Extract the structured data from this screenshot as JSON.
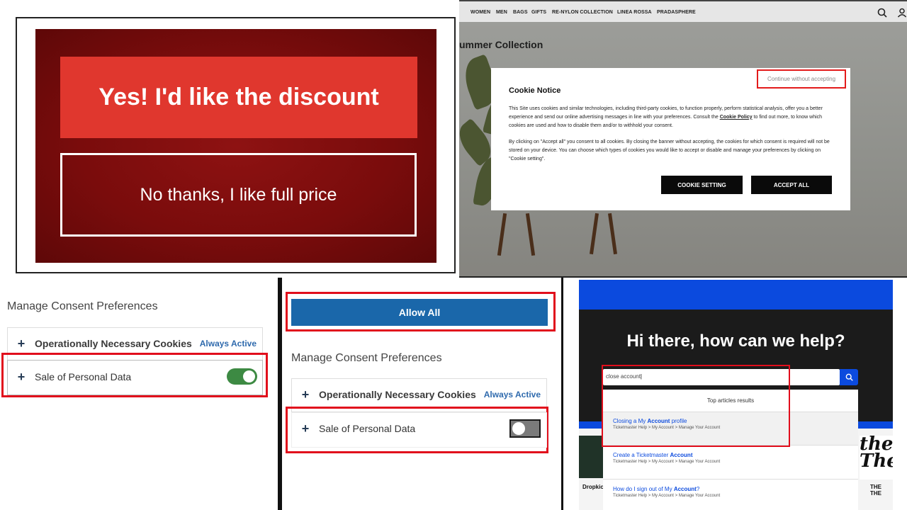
{
  "panel_discount": {
    "accept_label": "Yes! I'd like the discount",
    "decline_label": "No thanks, I like full price"
  },
  "panel_prada": {
    "nav": [
      "WOMEN",
      "MEN",
      "BAGS",
      "GIFTS",
      "RE-NYLON COLLECTION",
      "LINEA ROSSA",
      "PRADASPHERE"
    ],
    "collection_text": "ummer Collection",
    "cookie_title": "Cookie Notice",
    "continue_label": "Continue without accepting",
    "body_1": "This Site uses cookies and similar technologies, including third-party cookies, to function properly, perform statistical analysis, offer you a better experience and send our online advertising messages in line with your preferences. Consult the",
    "policy_link": "Cookie Policy",
    "body_1_end": " to find out more, to know which cookies are used and how to disable them and/or to withhold your consent.",
    "body_2": "By clicking on \"Accept all\" you consent to all cookies. By closing the banner without accepting, the cookies for which consent is required will not be stored on your device. You can choose which types of cookies you would like to accept or disable and manage your preferences by clicking on \"Cookie setting\".",
    "cookie_setting_label": "COOKIE SETTING",
    "accept_all_label": "ACCEPT ALL"
  },
  "panel_consent_left": {
    "title": "Manage Consent Preferences",
    "row_necessary": "Operationally Necessary Cookies",
    "always_active": "Always Active",
    "row_sale": "Sale of Personal Data",
    "sale_toggle_on": true
  },
  "panel_consent_right": {
    "allow_all_label": "Allow All",
    "title": "Manage Consent Preferences",
    "row_necessary": "Operationally Necessary Cookies",
    "always_active": "Always Active",
    "row_sale": "Sale of Personal Data",
    "sale_toggle_on": false
  },
  "panel_ticketmaster": {
    "headline": "Hi there, how can we help?",
    "search_value": "close account",
    "results_header": "Top articles results",
    "results": [
      {
        "title_pre": "Closing a My ",
        "title_bold": "Account",
        "title_post": " profile",
        "path": "Ticketmaster Help > My Account > Manage Your Account"
      },
      {
        "title_pre": "Create a Ticketmaster ",
        "title_bold": "Account",
        "title_post": "",
        "path": "Ticketmaster Help > My Account > Manage Your Account"
      },
      {
        "title_pre": "How do I sign out of My ",
        "title_bold": "Account",
        "title_post": "?",
        "path": "Ticketmaster Help > My Account > Manage Your Account"
      }
    ],
    "left_caption": "Dropkic",
    "right_caption": "THE THE",
    "right_logo": "the The"
  },
  "colors": {
    "highlight_red": "#e10e1c",
    "discount_red": "#e0372e",
    "consent_blue": "#1a67aa",
    "tm_blue": "#0b4ade"
  }
}
